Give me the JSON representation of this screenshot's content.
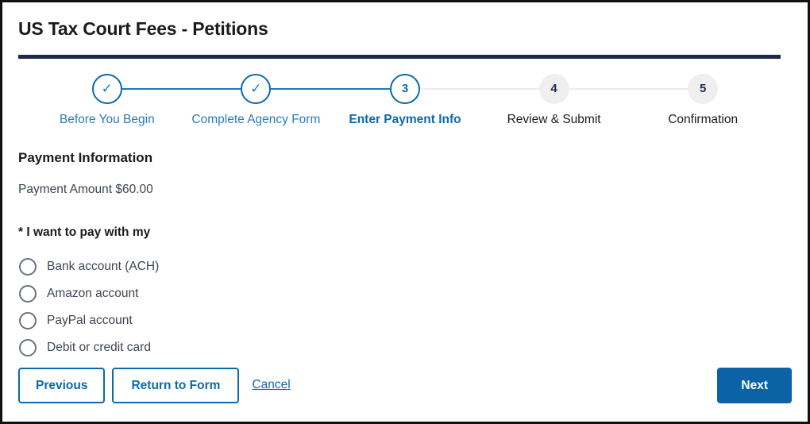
{
  "page": {
    "title": "US Tax Court Fees - Petitions",
    "accent_navy": "#1b2b47",
    "accent_blue": "#0b6aab",
    "primary_button_blue": "#0b62a4",
    "muted_circle_gray": "#efefef"
  },
  "stepper": {
    "steps": [
      {
        "number": "1",
        "marker": "✓",
        "label": "Before You Begin",
        "state": "done"
      },
      {
        "number": "2",
        "marker": "✓",
        "label": "Complete Agency Form",
        "state": "done"
      },
      {
        "number": "3",
        "marker": "3",
        "label": "Enter Payment Info",
        "state": "active"
      },
      {
        "number": "4",
        "marker": "4",
        "label": "Review & Submit",
        "state": "todo"
      },
      {
        "number": "5",
        "marker": "5",
        "label": "Confirmation",
        "state": "todo"
      }
    ]
  },
  "payment": {
    "section_title": "Payment Information",
    "amount_line": "Payment Amount $60.00",
    "amount_value": "$60.00",
    "pay_with_label": "* I want to pay with my",
    "options": [
      {
        "label": "Bank account (ACH)",
        "selected": false
      },
      {
        "label": "Amazon account",
        "selected": false
      },
      {
        "label": "PayPal account",
        "selected": false
      },
      {
        "label": "Debit or credit card",
        "selected": false
      }
    ]
  },
  "actions": {
    "previous_label": "Previous",
    "return_label": "Return to Form",
    "cancel_label": "Cancel",
    "next_label": "Next"
  }
}
